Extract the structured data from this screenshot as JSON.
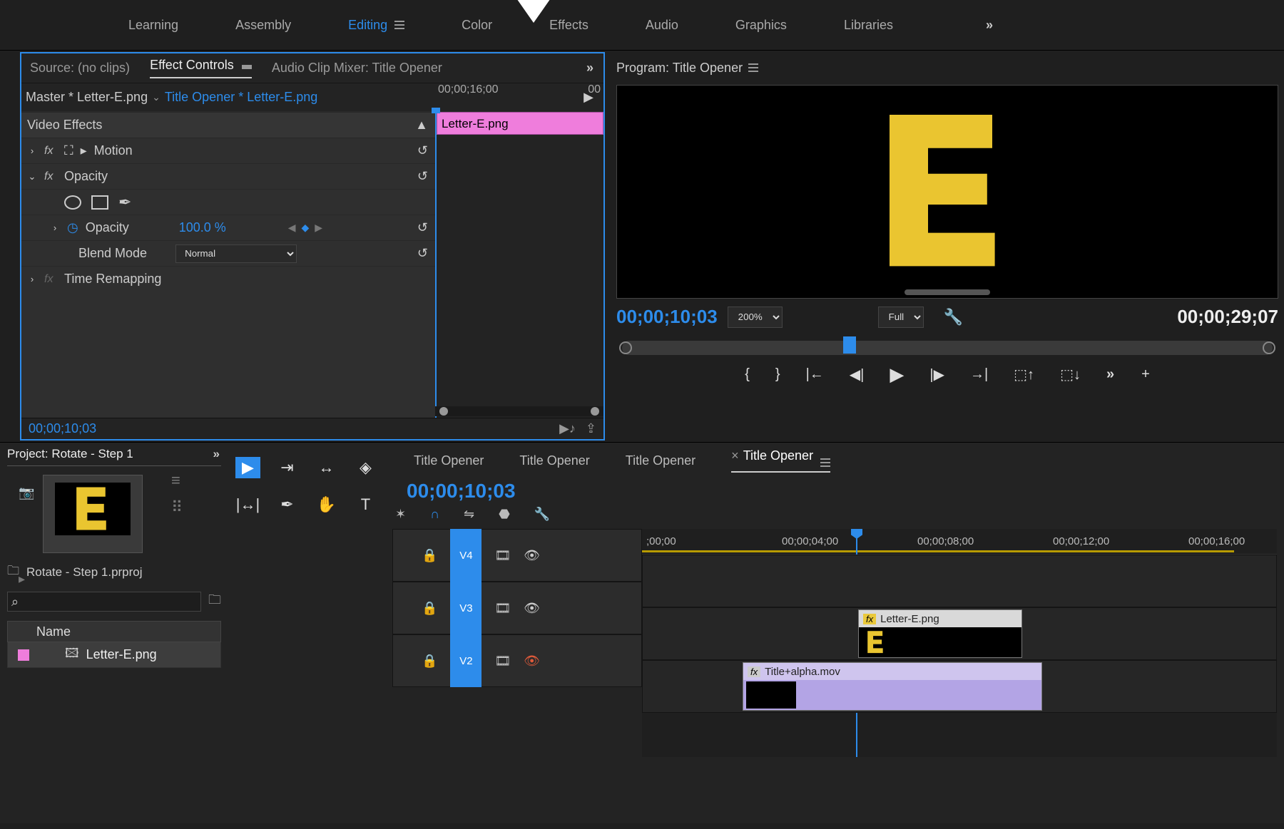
{
  "workspaces": [
    "Learning",
    "Assembly",
    "Editing",
    "Color",
    "Effects",
    "Audio",
    "Graphics",
    "Libraries"
  ],
  "activeWorkspaceIndex": 2,
  "sourceTabs": {
    "source": "Source: (no clips)",
    "effectControls": "Effect Controls",
    "audioMixer": "Audio Clip Mixer: Title Opener"
  },
  "effectControls": {
    "masterClip": "Master * Letter-E.png",
    "timelineClip": "Title Opener * Letter-E.png",
    "rulerStart": "00;00;16;00",
    "rulerEnd": "00",
    "clipName": "Letter-E.png",
    "videoEffectsHeader": "Video Effects",
    "motion": "Motion",
    "opacity": "Opacity",
    "opacityValue": "100.0 %",
    "blendMode": "Blend Mode",
    "blendModeValue": "Normal",
    "timeRemap": "Time Remapping",
    "timecode": "00;00;10;03"
  },
  "program": {
    "title": "Program: Title Opener",
    "timecode": "00;00;10;03",
    "zoom": "200%",
    "quality": "Full",
    "duration": "00;00;29;07"
  },
  "project": {
    "tab": "Project: Rotate - Step 1",
    "filename": "Rotate - Step 1.prproj",
    "listHeader": "Name",
    "item": "Letter-E.png"
  },
  "timeline": {
    "tabs": [
      "Title Opener",
      "Title Opener",
      "Title Opener",
      "Title Opener"
    ],
    "activeTabIndex": 3,
    "timecode": "00;00;10;03",
    "ruler": [
      ";00;00",
      "00;00;04;00",
      "00;00;08;00",
      "00;00;12;00",
      "00;00;16;00"
    ],
    "tracks": [
      "V4",
      "V3",
      "V2"
    ],
    "clips": {
      "v3": "Letter-E.png",
      "v2": "Title+alpha.mov"
    }
  }
}
